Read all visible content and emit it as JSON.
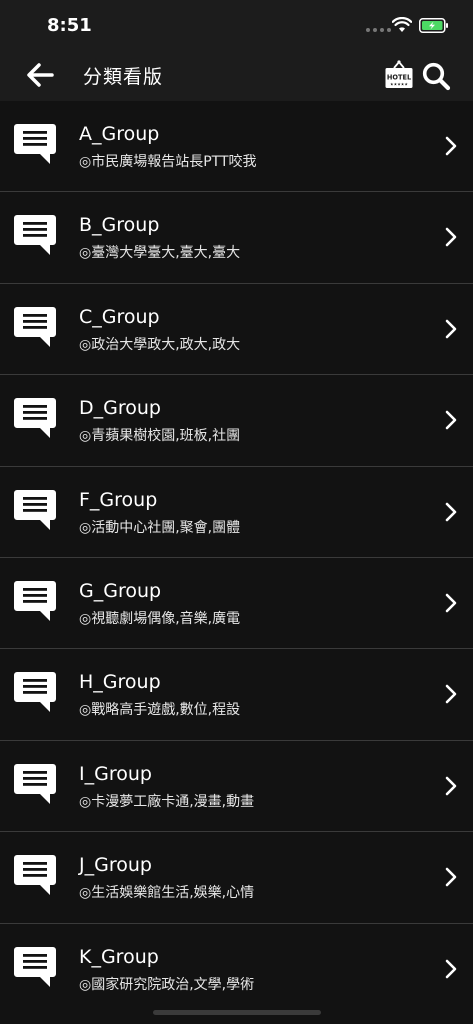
{
  "status_bar": {
    "time": "8:51"
  },
  "header": {
    "title": "分類看版",
    "hotel_badge": "HOTEL"
  },
  "boards": [
    {
      "name": "A_Group",
      "description": "◎市民廣場報告站長PTT咬我"
    },
    {
      "name": "B_Group",
      "description": "◎臺灣大學臺大,臺大,臺大"
    },
    {
      "name": "C_Group",
      "description": "◎政治大學政大,政大,政大"
    },
    {
      "name": "D_Group",
      "description": "◎青蘋果樹校園,班板,社團"
    },
    {
      "name": "F_Group",
      "description": "◎活動中心社團,聚會,團體"
    },
    {
      "name": "G_Group",
      "description": "◎視聽劇場偶像,音樂,廣電"
    },
    {
      "name": "H_Group",
      "description": "◎戰略高手遊戲,數位,程設"
    },
    {
      "name": "I_Group",
      "description": "◎卡漫夢工廠卡通,漫畫,動畫"
    },
    {
      "name": "J_Group",
      "description": "◎生活娛樂館生活,娛樂,心情"
    },
    {
      "name": "K_Group",
      "description": "◎國家研究院政治,文學,學術"
    }
  ],
  "colors": {
    "background": "#121212",
    "bar": "#1c1c1c",
    "separator": "#3a3a3a",
    "battery": "#4cd964"
  }
}
